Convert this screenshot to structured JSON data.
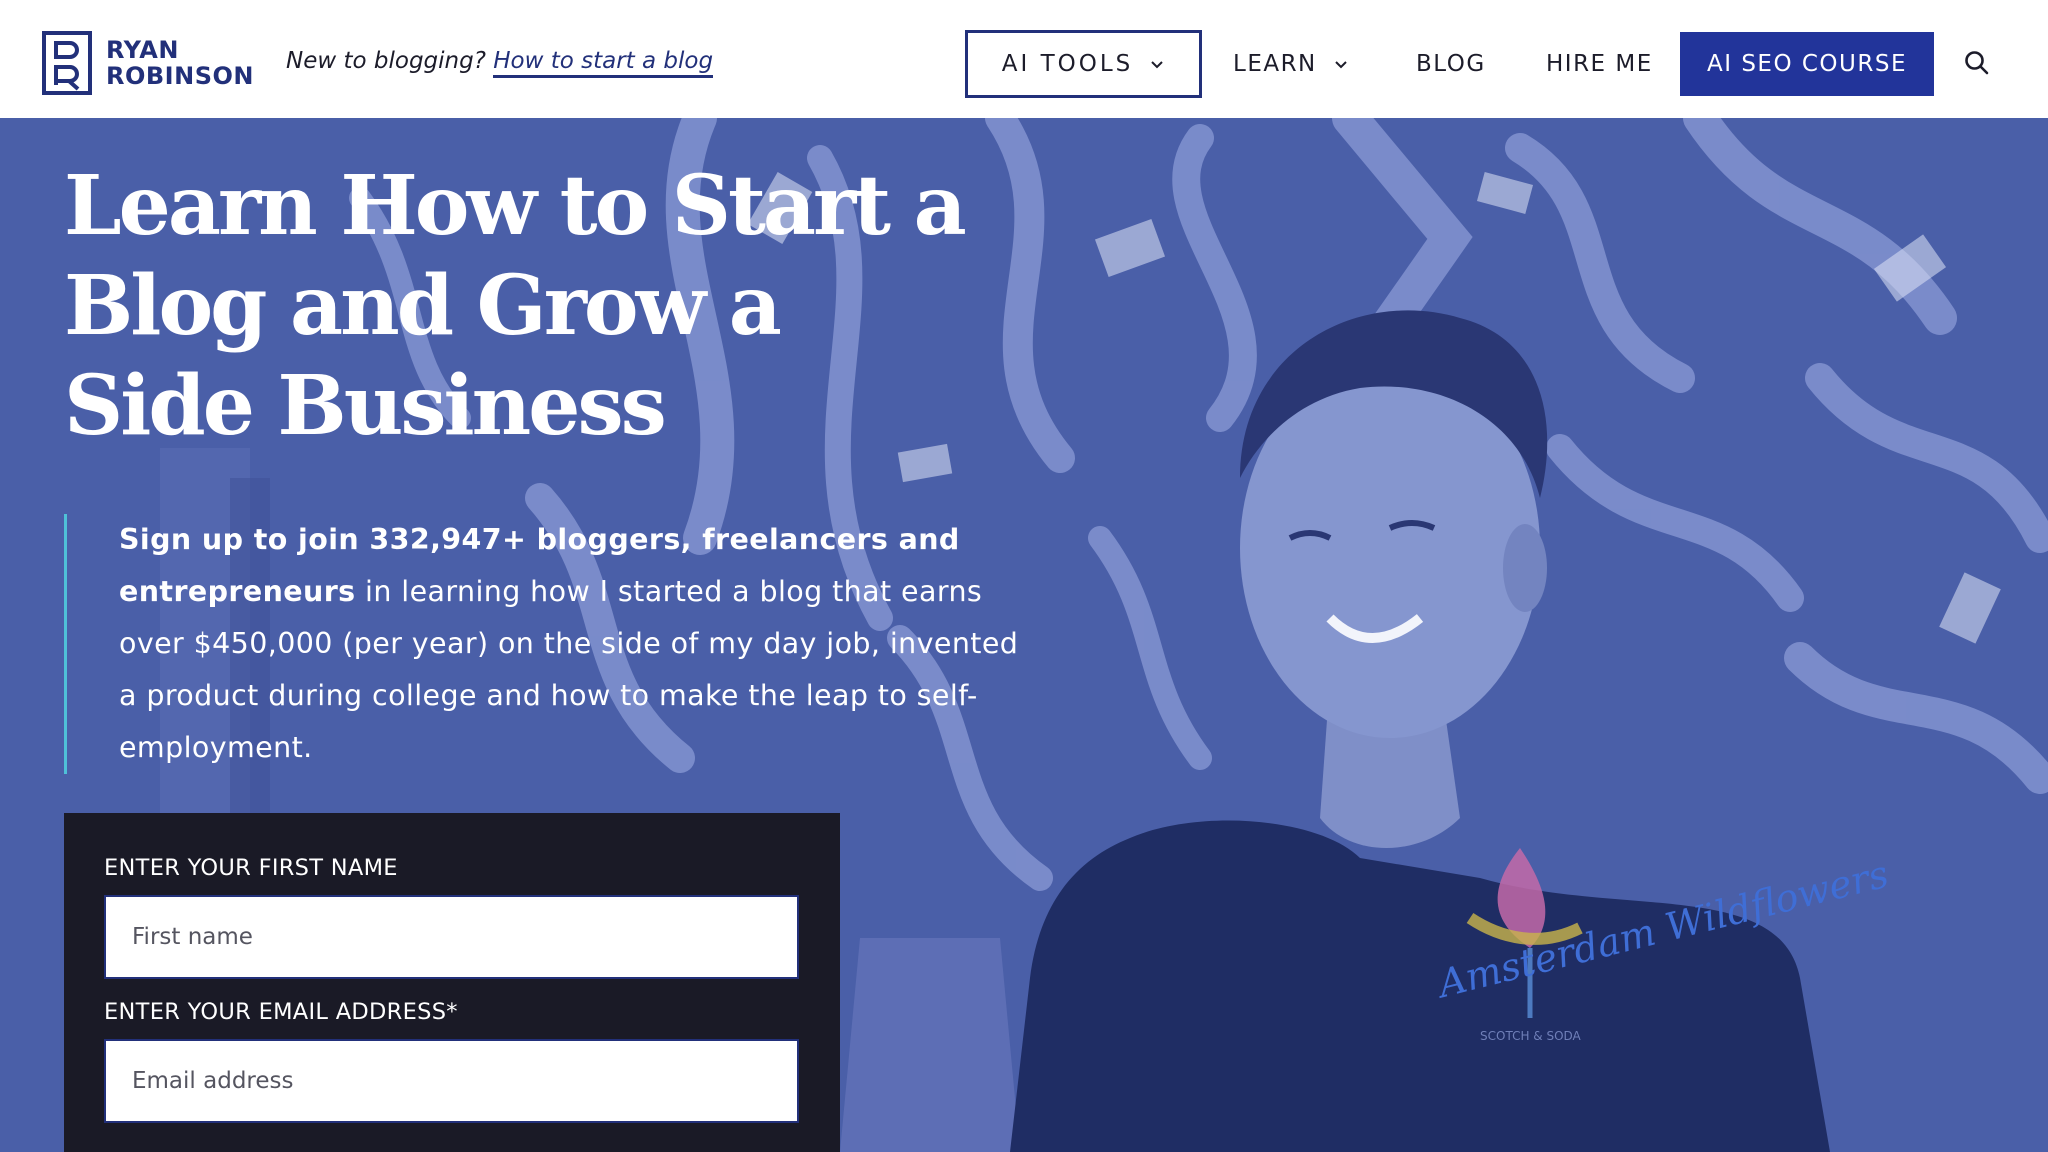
{
  "header": {
    "logo_line1": "RYAN",
    "logo_line2": "ROBINSON",
    "tagline_prefix": "New to blogging? ",
    "tagline_link": "How to start a blog",
    "nav": {
      "ai_tools": "AI TOOLS",
      "learn": "LEARN",
      "blog": "BLOG",
      "hire_me": "HIRE ME",
      "cta": "AI SEO COURSE"
    }
  },
  "hero": {
    "title": "Learn How to Start a Blog and Grow a Side Business",
    "intro_bold": "Sign up to join 332,947+ bloggers, freelancers and entrepreneurs",
    "intro_rest": " in learning how I started a blog that earns over $450,000 (per year) on the side of my day job, invented a product during college and how to make the leap to self-employment.",
    "tshirt_text": "Amsterdam Wildflowers",
    "tshirt_brand": "SCOTCH & SODA"
  },
  "signup": {
    "first_name_label": "ENTER YOUR FIRST NAME",
    "first_name_placeholder": "First name",
    "email_label": "ENTER YOUR EMAIL ADDRESS*",
    "email_placeholder": "Email address"
  },
  "colors": {
    "brand": "#22307a",
    "cta_bg": "#22349a",
    "hero_overlay": "#4a5fa8",
    "accent_line": "#4fc1d8",
    "form_bg": "#1a1a26"
  },
  "icons": [
    "logo-mark-icon",
    "chevron-down-icon",
    "search-icon"
  ]
}
